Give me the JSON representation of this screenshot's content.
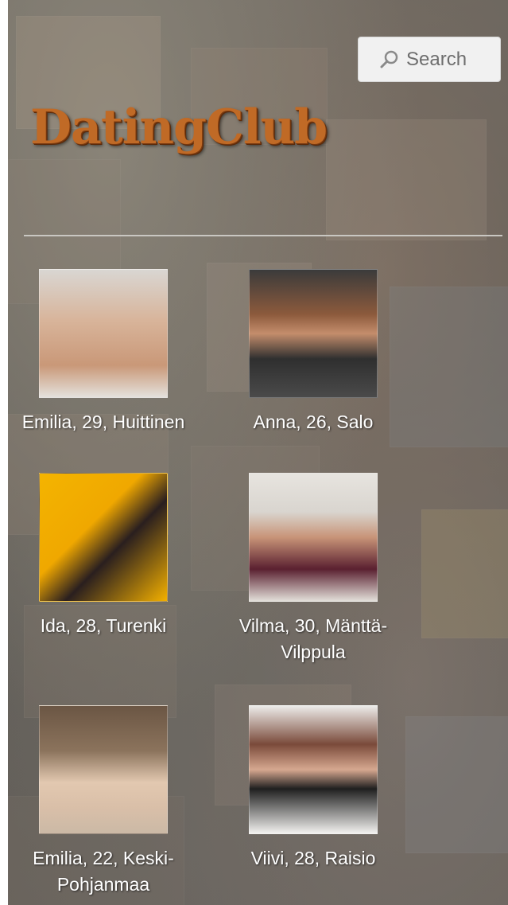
{
  "header": {
    "search_label": "Search",
    "logo_text": "DatingClub"
  },
  "profiles": [
    {
      "caption": "Emilia, 29, Huittinen",
      "photo_icon": "profile-photo"
    },
    {
      "caption": "Anna, 26, Salo",
      "photo_icon": "profile-photo"
    },
    {
      "caption": "Ida, 28, Turenki",
      "photo_icon": "profile-photo"
    },
    {
      "caption": "Vilma, 30, Mänttä-Vilppula",
      "photo_icon": "profile-photo"
    },
    {
      "caption": "Emilia, 22, Keski-Pohjanmaa",
      "photo_icon": "profile-photo"
    },
    {
      "caption": "Viivi, 28, Raisio",
      "photo_icon": "profile-photo"
    }
  ],
  "colors": {
    "logo": "#c06a26",
    "caption_text": "#ffffff",
    "search_bg": "#f1f1f1",
    "search_text": "#6e6e6e",
    "divider": "#c9c7c2"
  },
  "icons": {
    "search": "magnifier-icon"
  }
}
